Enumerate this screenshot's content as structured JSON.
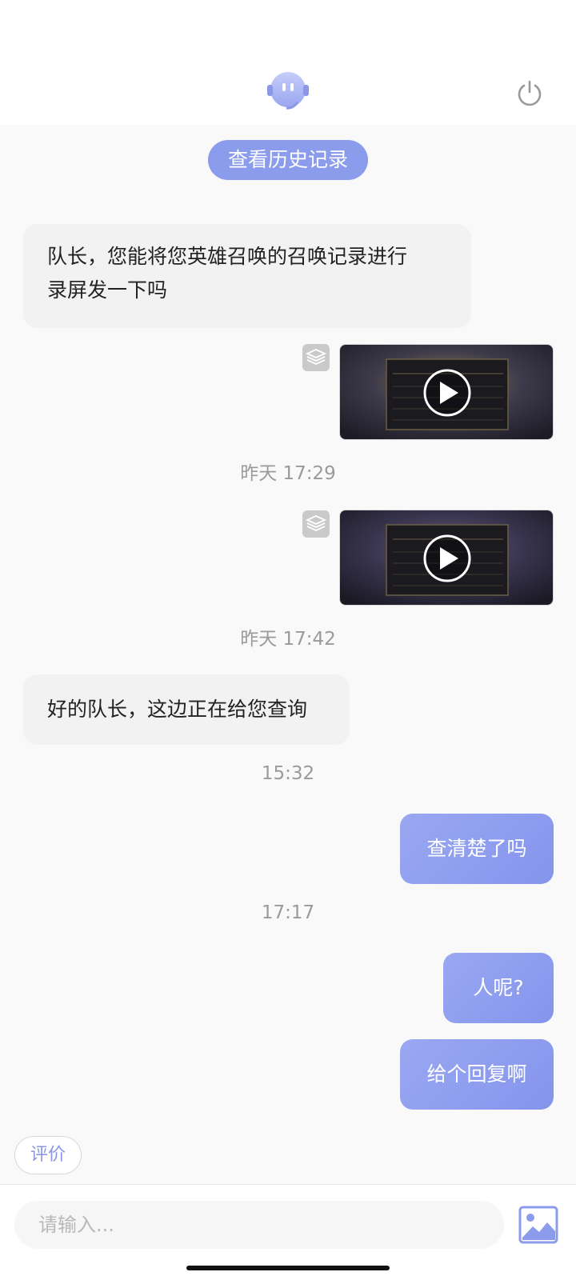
{
  "header": {
    "avatar_icon": "robot-assistant-icon",
    "power_icon": "power-icon"
  },
  "history_button": "查看历史记录",
  "messages": [
    {
      "side": "left",
      "text_line1": "队长，您能将您英雄召唤的召唤记录进行",
      "text_line2": "录屏发一下吗"
    },
    {
      "side": "right",
      "type": "video",
      "timestamp": "昨天 17:29"
    },
    {
      "side": "right",
      "type": "video",
      "timestamp": "昨天 17:42"
    },
    {
      "side": "left",
      "text": "好的队长，这边正在给您查询",
      "timestamp": "15:32"
    },
    {
      "side": "right",
      "text": "查清楚了吗",
      "timestamp": "17:17"
    },
    {
      "side": "right",
      "text": "人呢?"
    },
    {
      "side": "right",
      "text": "给个回复啊"
    }
  ],
  "rate_button": "评价",
  "input": {
    "placeholder": "请输入...",
    "image_icon": "image-upload-icon"
  },
  "colors": {
    "accent": "#8c9cec",
    "bubble_left": "#f2f2f2",
    "timestamp": "#9a9a9a"
  }
}
